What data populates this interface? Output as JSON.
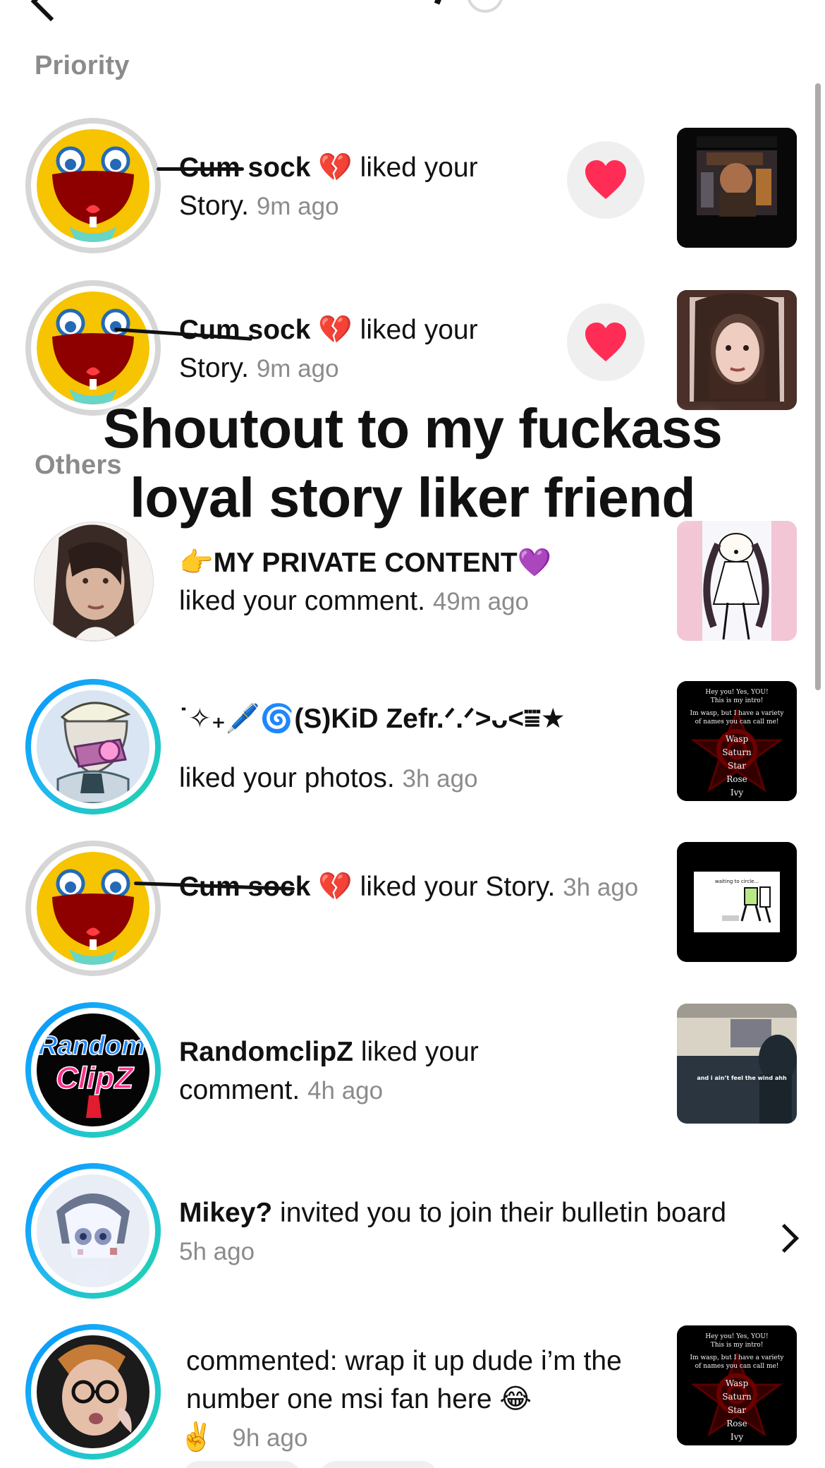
{
  "sections": {
    "priority": "Priority",
    "others": "Others"
  },
  "overlay_caption": "Shoutout to my fuckass\nloyal story liker friend",
  "notifications": {
    "n1": {
      "user": "Cum sock",
      "emoji": "💔",
      "action": " liked your Story.",
      "time": "9m ago"
    },
    "n2": {
      "user": "Cum sock",
      "emoji": "💔",
      "action": " liked your Story.",
      "time": "9m ago"
    },
    "n3": {
      "user_prefix_emoji": "👉",
      "user": "MY PRIVATE CONTENT",
      "user_suffix_emoji": "💜",
      "action": "liked your comment.",
      "time": "49m ago"
    },
    "n4": {
      "user": "˙✧₊🖊️🌀(S)KiD Zefr.ᐟ.ᐟ>ᴗ<⩸★",
      "action": "liked your photos.",
      "time": "3h ago"
    },
    "n5": {
      "user": "Cum sock",
      "emoji": "💔",
      "action": " liked your Story.",
      "time": "3h ago"
    },
    "n6": {
      "user": "RandomclipZ",
      "action": " liked your comment.",
      "time": "4h ago"
    },
    "n7": {
      "user": "Mikey?",
      "action": " invited you to join their bulletin board",
      "time": "5h ago"
    },
    "n8": {
      "action": "commented: wrap it up dude i’m the number one msi fan here 😂",
      "action_tail": "✌️",
      "time": "9h ago"
    }
  },
  "thumbnails": {
    "wasp_card": {
      "line1": "Hey you! Yes, YOU!",
      "line2": "This is my intro!",
      "line3": "Im wasp, but I have a variety",
      "line4": "of names you can call me!",
      "names": [
        "Wasp",
        "Saturn",
        "Star",
        "Rose",
        "Ivy"
      ]
    },
    "video_overlay": "and i ain’t feel the wind ahh"
  },
  "icons": {
    "heart": "heart-icon",
    "chevron": "chevron-right-icon",
    "scrollbar": "scrollbar"
  },
  "colors": {
    "muted_text": "#8b8b8b",
    "heart_red": "#ff2d55",
    "ring_blue": "#0094ff",
    "ring_teal": "#20d7a3",
    "ring_gray": "#d6d6d6"
  }
}
